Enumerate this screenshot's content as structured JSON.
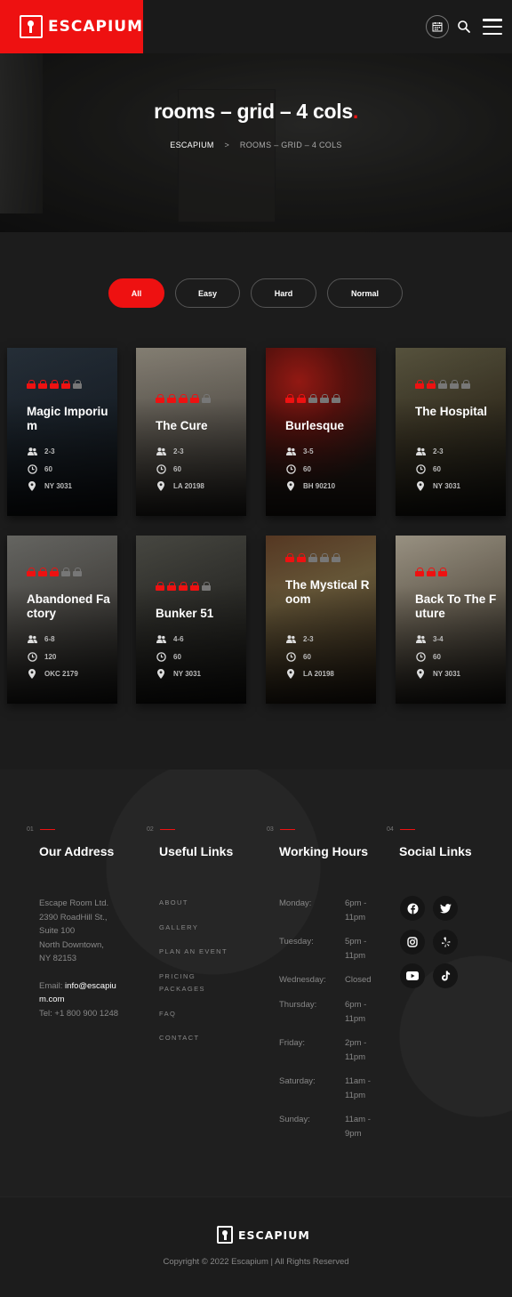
{
  "header": {
    "logo_text": "ESCAPIUM",
    "brand_color": "#ee1111",
    "icons": [
      "calendar-icon",
      "search-icon",
      "menu-icon"
    ]
  },
  "hero": {
    "title": "rooms – grid – 4 cols",
    "title_dot": ".",
    "breadcrumb": {
      "home": "ESCAPIUM",
      "separator": ">",
      "current": "ROOMS – GRID – 4 COLS"
    }
  },
  "filters": [
    {
      "label": "All",
      "active": true
    },
    {
      "label": "Easy",
      "active": false
    },
    {
      "label": "Hard",
      "active": false
    },
    {
      "label": "Normal",
      "active": false
    }
  ],
  "rooms": [
    {
      "name": "Magic Imporium",
      "difficulty": 4,
      "max": 5,
      "players": "2-3",
      "minutes": "60",
      "location": "NY 3031"
    },
    {
      "name": "The Cure",
      "difficulty": 4,
      "max": 5,
      "players": "2-3",
      "minutes": "60",
      "location": "LA 20198"
    },
    {
      "name": "Burlesque",
      "difficulty": 2,
      "max": 5,
      "players": "3-5",
      "minutes": "60",
      "location": "BH 90210"
    },
    {
      "name": "The Hospital",
      "difficulty": 2,
      "max": 5,
      "players": "2-3",
      "minutes": "60",
      "location": "NY 3031"
    },
    {
      "name": "Abandoned Factory",
      "difficulty": 3,
      "max": 5,
      "players": "6-8",
      "minutes": "120",
      "location": "OKC 2179"
    },
    {
      "name": "Bunker 51",
      "difficulty": 4,
      "max": 5,
      "players": "4-6",
      "minutes": "60",
      "location": "NY 3031"
    },
    {
      "name": "The Mystical Room",
      "difficulty": 2,
      "max": 5,
      "players": "2-3",
      "minutes": "60",
      "location": "LA 20198"
    },
    {
      "name": "Back To The Future",
      "difficulty": 3,
      "max": 3,
      "players": "3-4",
      "minutes": "60",
      "location": "NY 3031"
    }
  ],
  "footer": {
    "address": {
      "number": "01",
      "heading": "Our Address",
      "company": "Escape Room Ltd.",
      "street": "2390 RoadHill St.,",
      "suite": "Suite 100",
      "area": "North Downtown,",
      "city": "NY 82153",
      "email_label": "Email:",
      "email": "info@escapium.com",
      "tel": "Tel: +1 800 900 1248"
    },
    "links": {
      "number": "02",
      "heading": "Useful Links",
      "items": [
        "ABOUT",
        "GALLERY",
        "PLAN AN EVENT",
        "PRICING PACKAGES",
        "FAQ",
        "CONTACT"
      ]
    },
    "hours": {
      "number": "03",
      "heading": "Working Hours",
      "rows": [
        {
          "day": "Monday:",
          "time": "6pm - 11pm"
        },
        {
          "day": "Tuesday:",
          "time": "5pm - 11pm"
        },
        {
          "day": "Wednesday:",
          "time": "Closed"
        },
        {
          "day": "Thursday:",
          "time": "6pm - 11pm"
        },
        {
          "day": "Friday:",
          "time": "2pm - 11pm"
        },
        {
          "day": "Saturday:",
          "time": "11am - 11pm"
        },
        {
          "day": "Sunday:",
          "time": "11am - 9pm"
        }
      ]
    },
    "social": {
      "number": "04",
      "heading": "Social Links",
      "icons": [
        "facebook-icon",
        "twitter-icon",
        "instagram-icon",
        "yelp-icon",
        "youtube-icon",
        "tiktok-icon"
      ]
    }
  },
  "bottom": {
    "logo_text": "ESCAPIUM",
    "copyright": "Copyright © 2022 Escapium | All Rights Reserved"
  }
}
